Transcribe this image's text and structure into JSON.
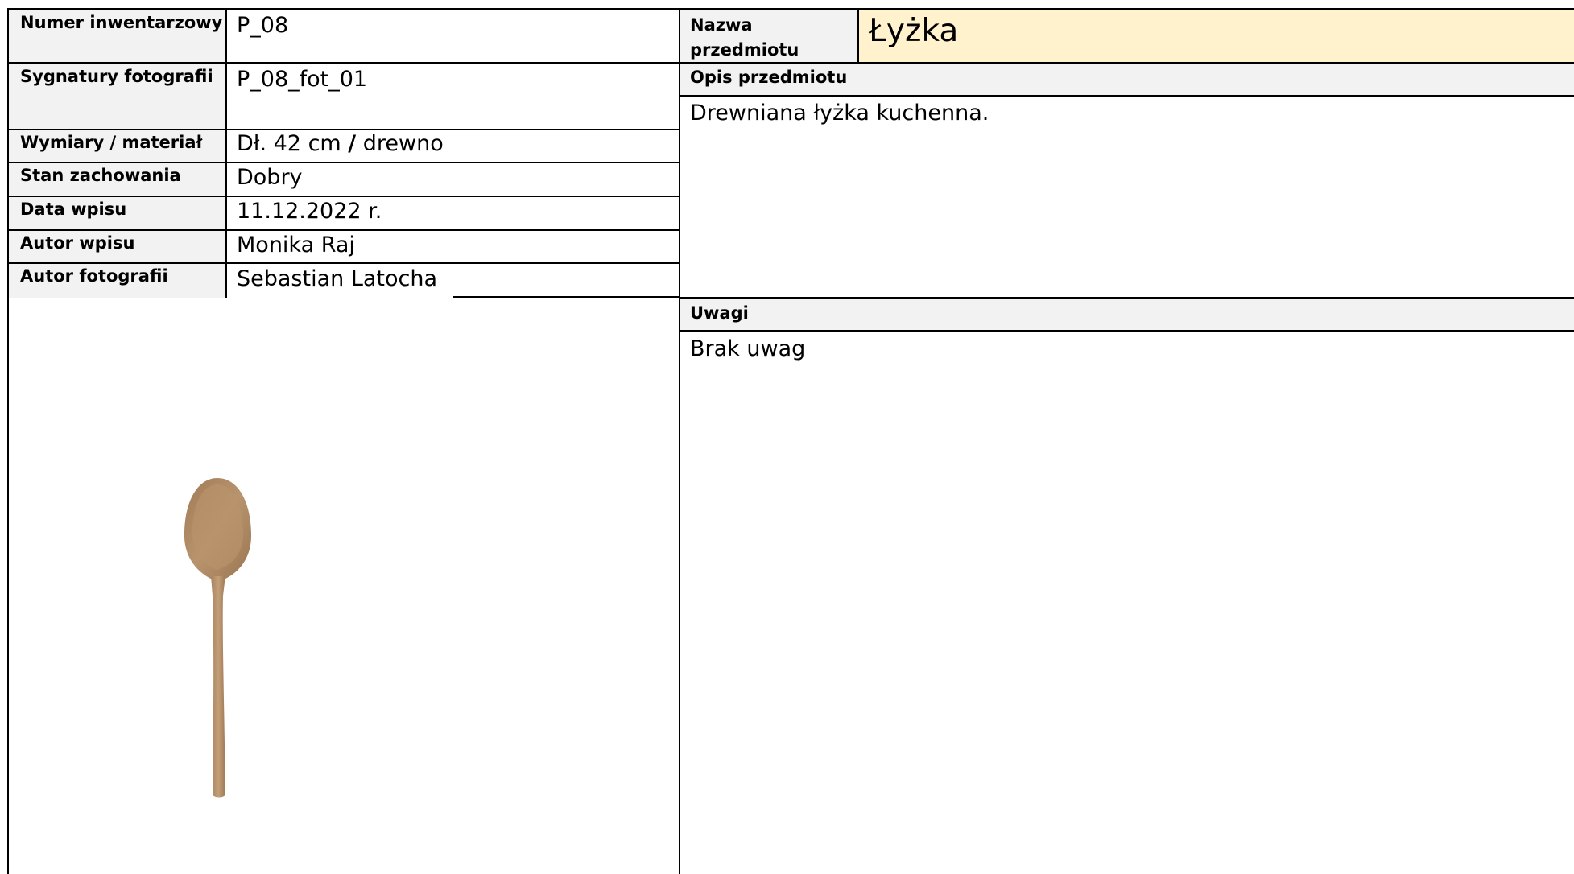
{
  "fields": [
    {
      "label": "Numer inwentarzowy",
      "value": "P_08"
    },
    {
      "label": "Sygnatury fotografii",
      "value": "P_08_fot_01"
    },
    {
      "label": "Wymiary / materiał",
      "value_prefix": "Dł. 42 cm ",
      "value_sep": "/",
      "value_suffix": " drewno"
    },
    {
      "label": "Stan zachowania",
      "value": "Dobry"
    },
    {
      "label": "Data wpisu",
      "value": "11.12.2022 r."
    },
    {
      "label": "Autor wpisu",
      "value": "Monika Raj"
    },
    {
      "label": "Autor fotografii",
      "value": "Sebastian Latocha"
    }
  ],
  "name": {
    "label_line1": "Nazwa",
    "label_line2": "przedmiotu",
    "value": "Łyżka",
    "highlight_color": "#fff2cc"
  },
  "description": {
    "label": "Opis przedmiotu",
    "text": "Drewniana łyżka kuchenna.",
    "header_color": "#f2f2f2"
  },
  "notes": {
    "label": "Uwagi",
    "text": "Brak uwag",
    "header_color": "#f2f2f2"
  },
  "photo": {
    "icon": "wooden-spoon-photo",
    "wood_color": "#b08a64"
  }
}
